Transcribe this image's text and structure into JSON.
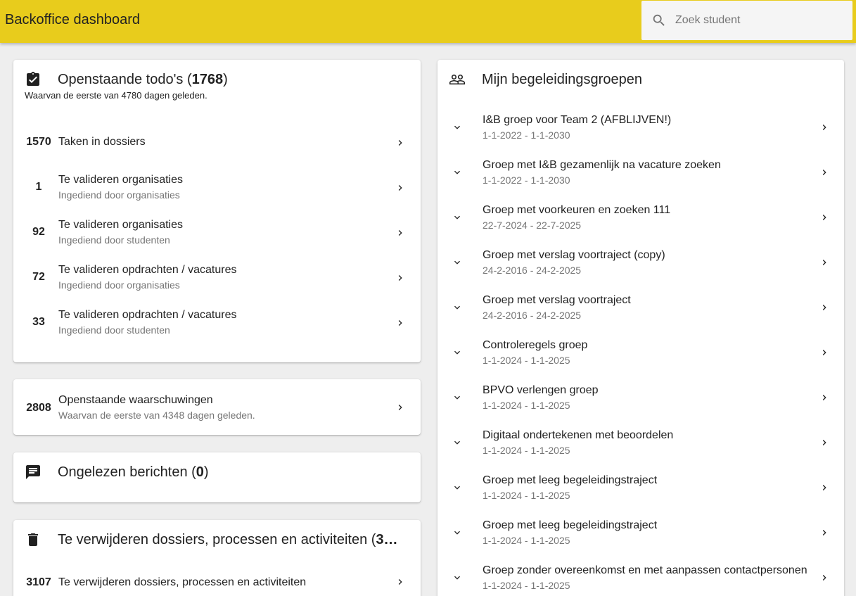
{
  "header": {
    "title": "Backoffice dashboard"
  },
  "search": {
    "placeholder": "Zoek student",
    "value": ""
  },
  "todos": {
    "title_text": "Openstaande todo's (",
    "count": "1768",
    "title_close": ")",
    "subtitle": "Waarvan de eerste van 4780 dagen geleden.",
    "items": [
      {
        "count": "1570",
        "label": "Taken in dossiers",
        "sub": ""
      },
      {
        "count": "1",
        "label": "Te valideren organisaties",
        "sub": "Ingediend door organisaties"
      },
      {
        "count": "92",
        "label": "Te valideren organisaties",
        "sub": "Ingediend door studenten"
      },
      {
        "count": "72",
        "label": "Te valideren opdrachten / vacatures",
        "sub": "Ingediend door organisaties"
      },
      {
        "count": "33",
        "label": "Te valideren opdrachten / vacatures",
        "sub": "Ingediend door studenten"
      }
    ]
  },
  "warnings": {
    "count": "2808",
    "label": "Openstaande waarschuwingen",
    "sub": "Waarvan de eerste van 4348 dagen geleden."
  },
  "messages": {
    "title_text": "Ongelezen berichten (",
    "count": "0",
    "title_close": ")"
  },
  "delete": {
    "title_text": "Te verwijderen dossiers, processen en activiteiten (",
    "count": "3…",
    "items": [
      {
        "count": "3107",
        "label": "Te verwijderen dossiers, processen en activiteiten"
      }
    ]
  },
  "groups": {
    "title": "Mijn begeleidingsgroepen",
    "items": [
      {
        "name": "I&B groep voor Team 2 (AFBLIJVEN!)",
        "period": "1-1-2022 - 1-1-2030"
      },
      {
        "name": "Groep met I&B gezamenlijk na vacature zoeken",
        "period": "1-1-2022 - 1-1-2030"
      },
      {
        "name": "Groep met voorkeuren en zoeken 111",
        "period": "22-7-2024 - 22-7-2025"
      },
      {
        "name": "Groep met verslag voortraject (copy)",
        "period": "24-2-2016 - 24-2-2025"
      },
      {
        "name": "Groep met verslag voortraject",
        "period": "24-2-2016 - 24-2-2025"
      },
      {
        "name": "Controleregels groep",
        "period": "1-1-2024 - 1-1-2025"
      },
      {
        "name": "BPVO verlengen groep",
        "period": "1-1-2024 - 1-1-2025"
      },
      {
        "name": "Digitaal ondertekenen met beoordelen",
        "period": "1-1-2024 - 1-1-2025"
      },
      {
        "name": "Groep met leeg begeleidingstraject",
        "period": "1-1-2024 - 1-1-2025"
      },
      {
        "name": "Groep met leeg begeleidingstraject",
        "period": "1-1-2024 - 1-1-2025"
      },
      {
        "name": "Groep zonder overeenkomst en met aanpassen contactpersonen",
        "period": "1-1-2024 - 1-1-2025"
      }
    ]
  },
  "colors": {
    "header": "#e8cc1c",
    "background": "#eeeeee",
    "card": "#ffffff",
    "secondary_text": "#757575"
  },
  "icons": {
    "search": "search-icon",
    "todos": "assignment-turned-in-icon",
    "messages": "chat-icon",
    "delete": "trash-icon",
    "groups": "people-icon",
    "row_chevron": "chevron-right-icon",
    "group_expand": "chevron-down-icon"
  }
}
